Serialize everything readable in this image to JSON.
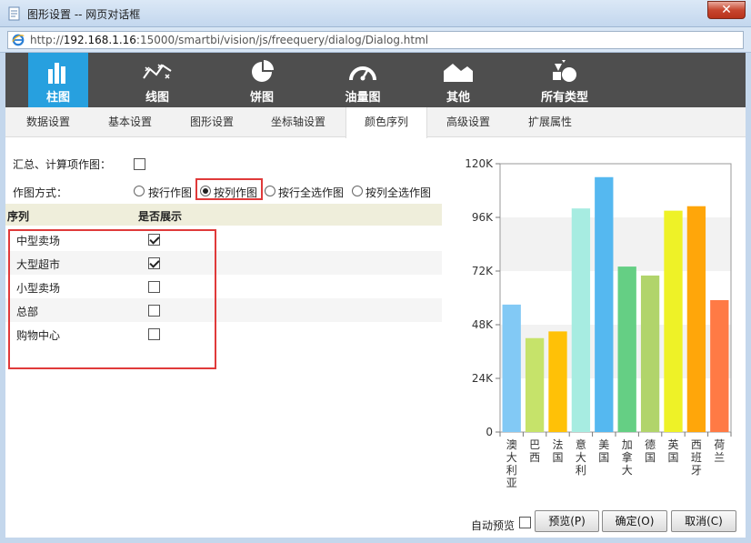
{
  "window": {
    "title": "图形设置 -- 网页对话框",
    "close_label": "✕",
    "url_prefix": "http://",
    "url_host": "192.168.1.16",
    "url_rest": ":15000/smartbi/vision/js/freequery/dialog/Dialog.html"
  },
  "chart_types": [
    {
      "label": "柱图",
      "icon": "bar-chart-icon",
      "active": true
    },
    {
      "label": "线图",
      "icon": "line-chart-icon",
      "active": false
    },
    {
      "label": "饼图",
      "icon": "pie-chart-icon",
      "active": false
    },
    {
      "label": "油量图",
      "icon": "gauge-icon",
      "active": false
    },
    {
      "label": "其他",
      "icon": "area-chart-icon",
      "active": false
    },
    {
      "label": "所有类型",
      "icon": "shapes-icon",
      "active": false
    }
  ],
  "tabs": [
    {
      "label": "数据设置",
      "active": false
    },
    {
      "label": "基本设置",
      "active": false
    },
    {
      "label": "图形设置",
      "active": false
    },
    {
      "label": "坐标轴设置",
      "active": false
    },
    {
      "label": "颜色序列",
      "active": true
    },
    {
      "label": "高级设置",
      "active": false
    },
    {
      "label": "扩展属性",
      "active": false
    }
  ],
  "form": {
    "summary_label": "汇总、计算项作图：",
    "summary_checked": false,
    "mode_label": "作图方式：",
    "modes": [
      {
        "label": "按行作图",
        "checked": false
      },
      {
        "label": "按列作图",
        "checked": true
      },
      {
        "label": "按行全选作图",
        "checked": false
      },
      {
        "label": "按列全选作图",
        "checked": false
      }
    ]
  },
  "table": {
    "headers": [
      "序列",
      "是否展示"
    ],
    "rows": [
      {
        "name": "中型卖场",
        "shown": true
      },
      {
        "name": "大型超市",
        "shown": true
      },
      {
        "name": "小型卖场",
        "shown": false
      },
      {
        "name": "总部",
        "shown": false
      },
      {
        "name": "购物中心",
        "shown": false
      }
    ]
  },
  "footer": {
    "auto_preview_label": "自动预览",
    "auto_preview_checked": false,
    "preview_label": "预览(P)",
    "ok_label": "确定(O)",
    "cancel_label": "取消(C)"
  },
  "chart_data": {
    "type": "bar",
    "categories": [
      "澳大利亚",
      "巴西",
      "法国",
      "意大利",
      "美国",
      "加拿大",
      "德国",
      "英国",
      "西班牙",
      "荷兰"
    ],
    "values": [
      57000,
      42000,
      45000,
      100000,
      114000,
      74000,
      70000,
      99000,
      101000,
      59000
    ],
    "colors": [
      "#82c9f5",
      "#c6e36a",
      "#ffc107",
      "#a7ece1",
      "#55b8f0",
      "#65cf84",
      "#b1d46b",
      "#eef227",
      "#ffa60a",
      "#ff7a45"
    ],
    "ylim": [
      0,
      120000
    ],
    "yticks": [
      "0",
      "24K",
      "48K",
      "72K",
      "96K",
      "120K"
    ],
    "ytick_values": [
      0,
      24000,
      48000,
      72000,
      96000,
      120000
    ],
    "grid": "alternating-bands"
  }
}
